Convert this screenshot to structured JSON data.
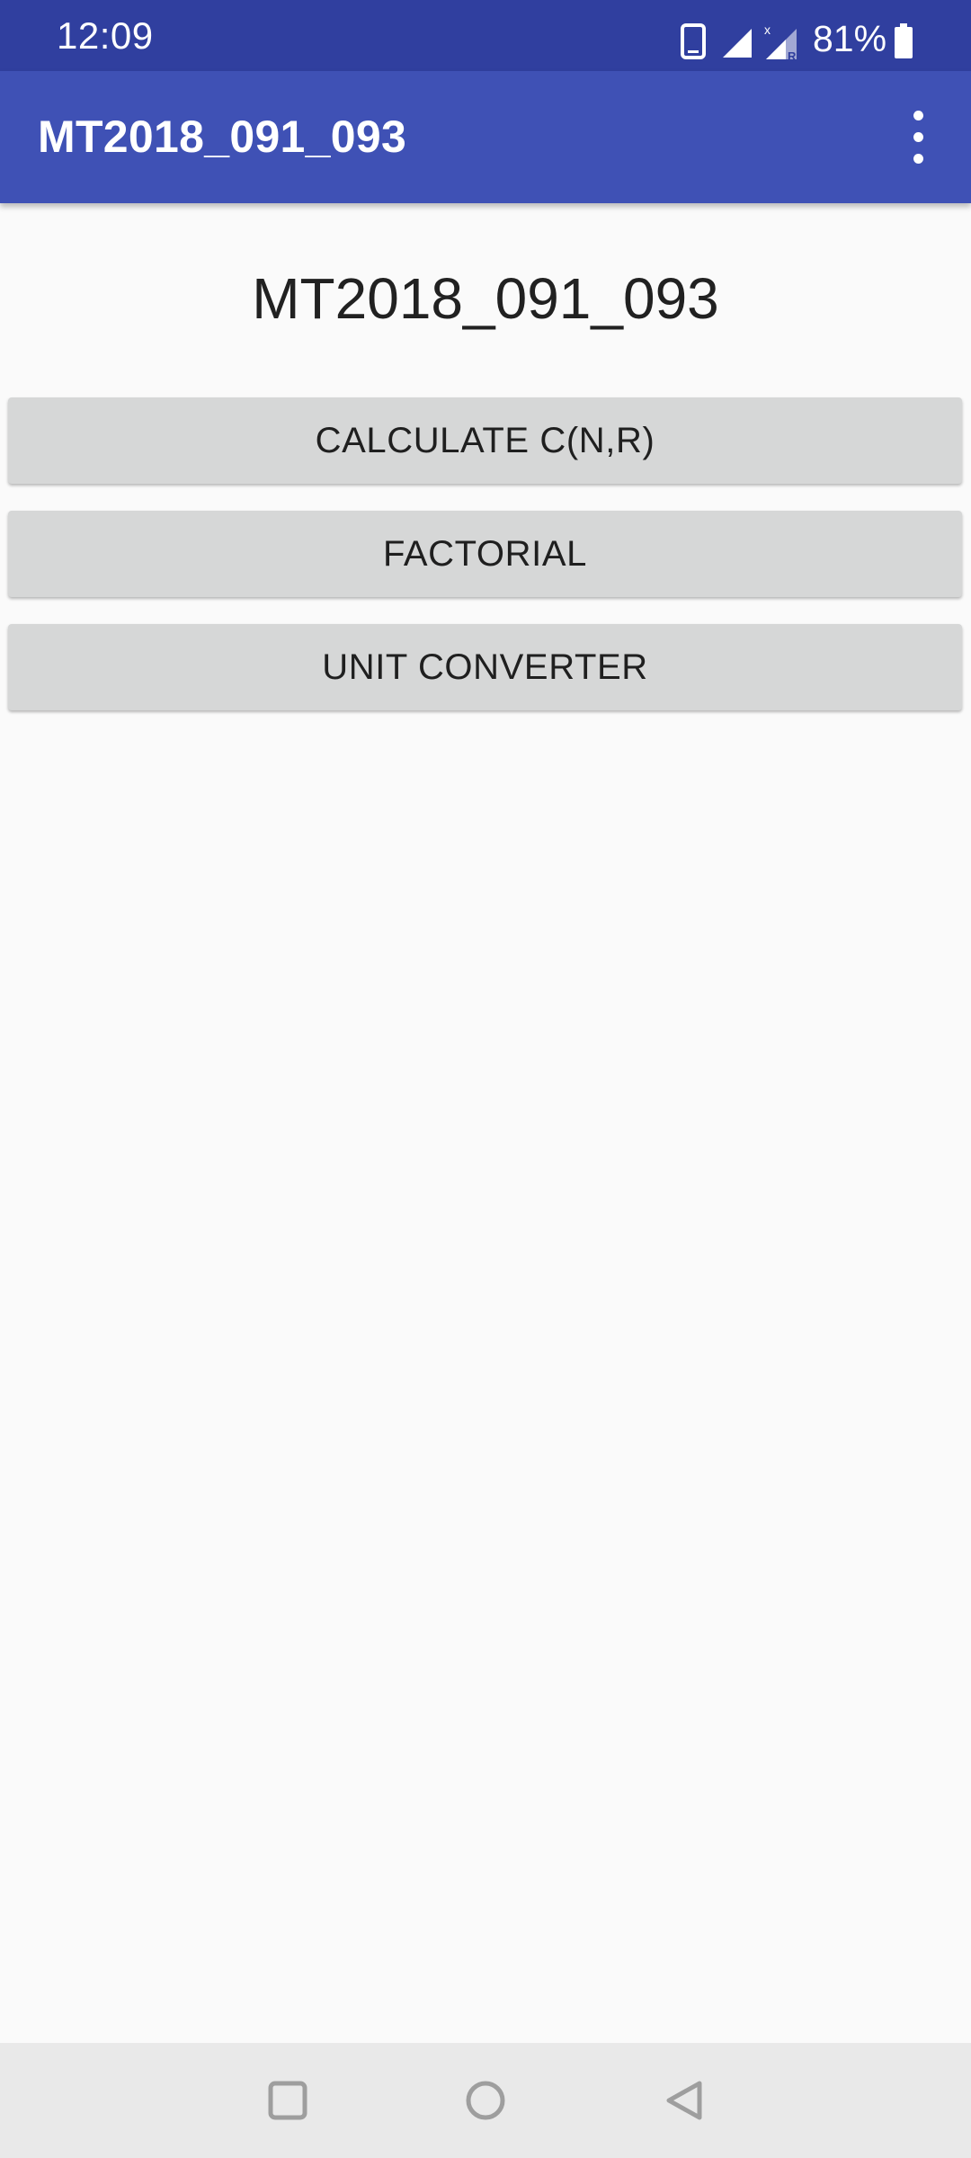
{
  "status_bar": {
    "time": "12:09",
    "battery_percent": "81%",
    "icons": [
      "phone-icon",
      "signal-icon",
      "signal-roaming-icon",
      "battery-icon"
    ]
  },
  "app_bar": {
    "title": "MT2018_091_093",
    "overflow_icon": "more-vert-icon"
  },
  "main": {
    "heading": "MT2018_091_093",
    "buttons": [
      {
        "label": "CALCULATE C(N,R)"
      },
      {
        "label": "FACTORIAL"
      },
      {
        "label": "UNIT CONVERTER"
      }
    ]
  },
  "nav_bar": {
    "icons": [
      "recents-icon",
      "home-icon",
      "back-icon"
    ]
  },
  "colors": {
    "status_bar": "#303f9f",
    "app_bar": "#3f51b5",
    "background": "#fafafa",
    "button": "#d6d7d7",
    "nav_bar": "#e9e9e9"
  }
}
